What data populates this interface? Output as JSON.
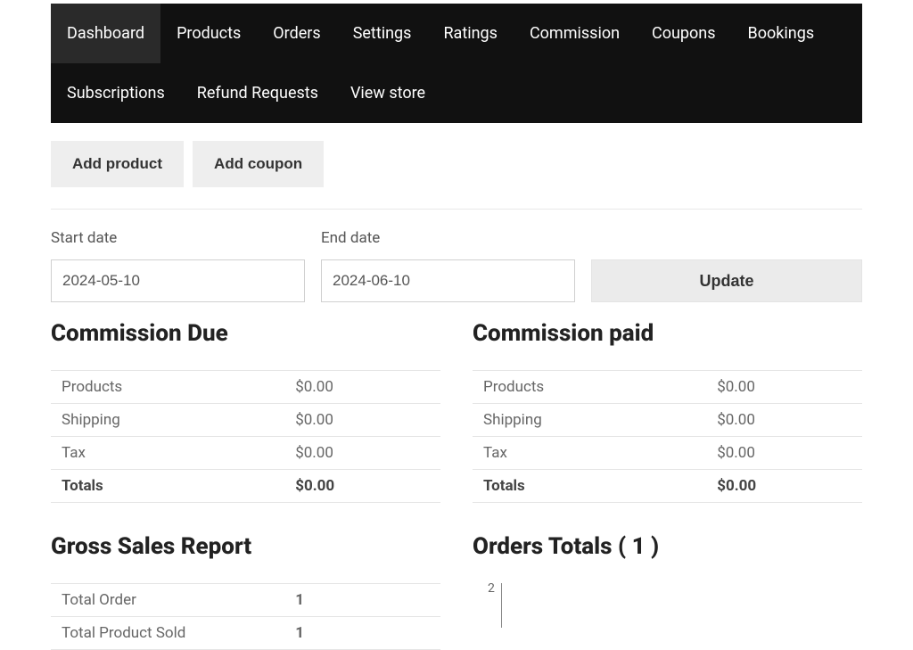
{
  "nav": {
    "items": [
      {
        "label": "Dashboard",
        "active": true
      },
      {
        "label": "Products"
      },
      {
        "label": "Orders"
      },
      {
        "label": "Settings"
      },
      {
        "label": "Ratings"
      },
      {
        "label": "Commission"
      },
      {
        "label": "Coupons"
      },
      {
        "label": "Bookings"
      },
      {
        "label": "Subscriptions"
      },
      {
        "label": "Refund Requests"
      },
      {
        "label": "View store"
      }
    ]
  },
  "actions": {
    "add_product": "Add product",
    "add_coupon": "Add coupon"
  },
  "filter": {
    "start_label": "Start date",
    "start_value": "2024-05-10",
    "end_label": "End date",
    "end_value": "2024-06-10",
    "update_label": "Update"
  },
  "commission_due": {
    "title": "Commission Due",
    "rows": [
      {
        "label": "Products",
        "value": "$0.00"
      },
      {
        "label": "Shipping",
        "value": "$0.00"
      },
      {
        "label": "Tax",
        "value": "$0.00"
      },
      {
        "label": "Totals",
        "value": "$0.00",
        "bold": true
      }
    ]
  },
  "commission_paid": {
    "title": "Commission paid",
    "rows": [
      {
        "label": "Products",
        "value": "$0.00"
      },
      {
        "label": "Shipping",
        "value": "$0.00"
      },
      {
        "label": "Tax",
        "value": "$0.00"
      },
      {
        "label": "Totals",
        "value": "$0.00",
        "bold": true
      }
    ]
  },
  "gross_sales": {
    "title": "Gross Sales Report",
    "rows": [
      {
        "label": "Total Order",
        "value": "1",
        "bold_val": true
      },
      {
        "label": "Total Product Sold",
        "value": "1",
        "bold_val": true
      }
    ]
  },
  "orders_totals": {
    "title": "Orders Totals ( 1 )",
    "y_tick": "2"
  }
}
